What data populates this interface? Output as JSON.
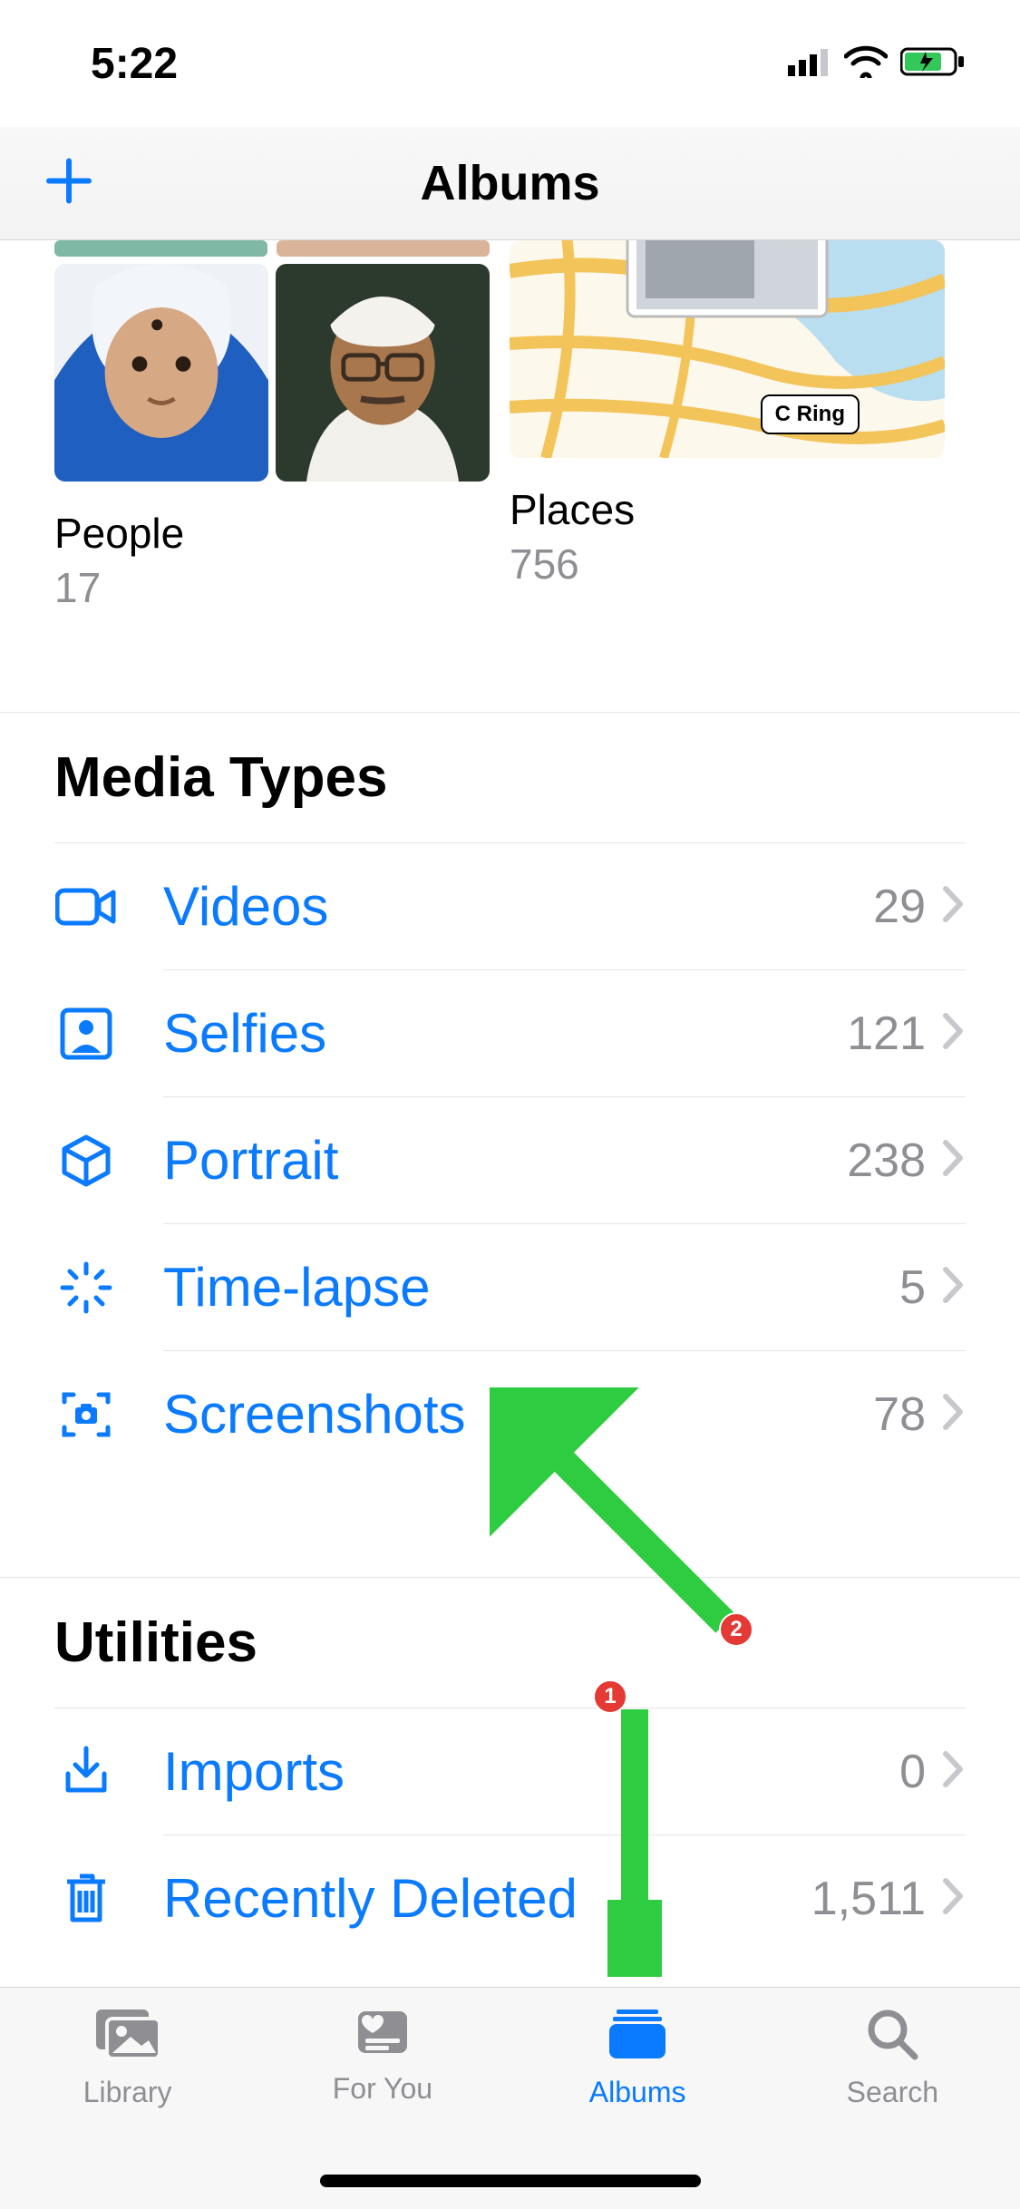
{
  "status": {
    "time": "5:22"
  },
  "nav": {
    "title": "Albums"
  },
  "albums": {
    "people": {
      "title": "People",
      "count": "17"
    },
    "places": {
      "title": "Places",
      "count": "756",
      "map_label": "C Ring"
    }
  },
  "sections": {
    "media_types": {
      "title": "Media Types",
      "items": [
        {
          "label": "Videos",
          "count": "29"
        },
        {
          "label": "Selfies",
          "count": "121"
        },
        {
          "label": "Portrait",
          "count": "238"
        },
        {
          "label": "Time-lapse",
          "count": "5"
        },
        {
          "label": "Screenshots",
          "count": "78"
        }
      ]
    },
    "utilities": {
      "title": "Utilities",
      "items": [
        {
          "label": "Imports",
          "count": "0"
        },
        {
          "label": "Recently Deleted",
          "count": "1,511"
        }
      ]
    }
  },
  "tabs": [
    {
      "label": "Library",
      "active": false
    },
    {
      "label": "For You",
      "active": false
    },
    {
      "label": "Albums",
      "active": true
    },
    {
      "label": "Search",
      "active": false
    }
  ],
  "annotations": [
    {
      "num": "1"
    },
    {
      "num": "2"
    }
  ]
}
